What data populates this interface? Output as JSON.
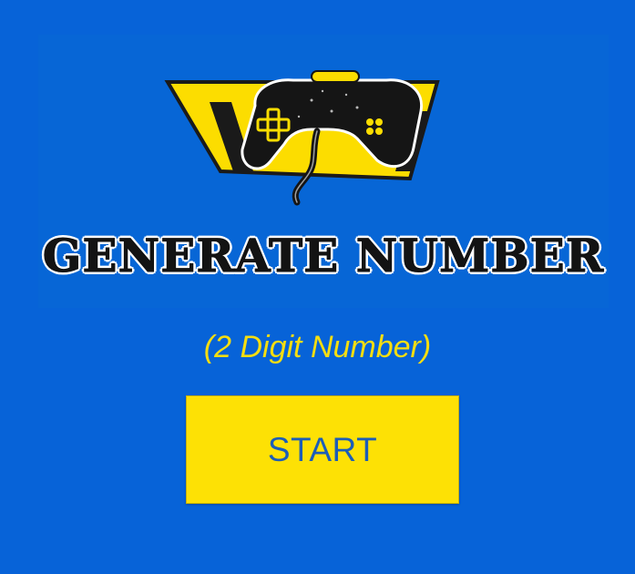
{
  "colors": {
    "background": "#0763d8",
    "accent_yellow": "#fde105",
    "subtitle_yellow": "#f6de10",
    "button_text_blue": "#1c5db8"
  },
  "logo": {
    "title": "GENERATE NUMBER",
    "icon": "gamepad-icon"
  },
  "subtitle": "(2 Digit Number)",
  "start_button": {
    "label": "START"
  }
}
